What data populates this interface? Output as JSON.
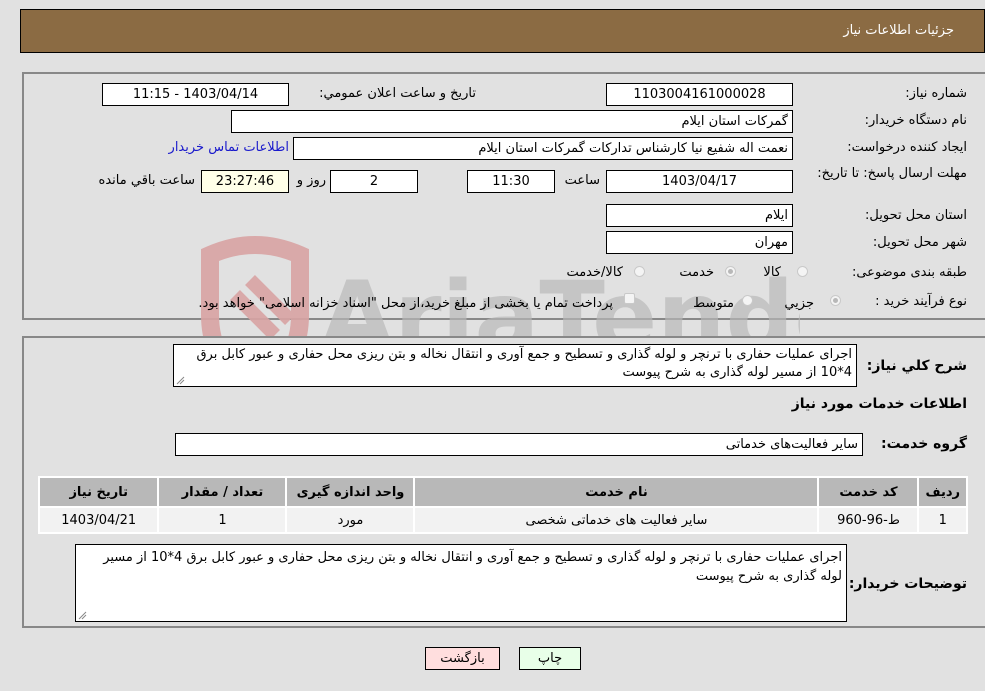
{
  "header": {
    "title": "جزئیات اطلاعات نیاز"
  },
  "info": {
    "need_number_label": "شماره نیاز:",
    "need_number": "1103004161000028",
    "announce_label": "تاريخ و ساعت اعلان عمومي:",
    "announce_value": "1403/04/14 - 11:15",
    "buyer_org_label": "نام دستگاه خريدار:",
    "buyer_org": "گمرکات استان ايلام",
    "creator_label": "ايجاد کننده درخواست:",
    "creator": "نعمت اله شفیع نیا کارشناس تدارکات گمرکات استان ایلام",
    "buyer_contact_link": "اطلاعات تماس خريدار",
    "deadline_label": "مهلت ارسال پاسخ: تا تاریخ:",
    "deadline_date": "1403/04/17",
    "time_label": "ساعت",
    "deadline_time": "11:30",
    "days_value": "2",
    "days_label": "روز و",
    "remaining_time": "23:27:46",
    "remaining_label": "ساعت باقي مانده",
    "province_label": "استان محل تحویل:",
    "province": "ایلام",
    "city_label": "شهر محل تحویل:",
    "city": "مهران",
    "category_label": "طبقه بندی موضوعی:",
    "category_options": [
      {
        "label": "کالا",
        "checked": false
      },
      {
        "label": "خدمت",
        "checked": true
      },
      {
        "label": "کالا/خدمت",
        "checked": false
      }
    ],
    "purchase_type_label": "نوع فرآیند خرید :",
    "purchase_type_options": [
      {
        "label": "جزيي",
        "checked": true
      },
      {
        "label": "متوسط",
        "checked": false
      }
    ],
    "treasury_note": "پرداخت تمام یا بخشی از مبلغ خرید،از محل \"اسناد خزانه اسلامی\" خواهد بود.",
    "treasury_checked": false
  },
  "details": {
    "general_desc_label": "شرح کلي نياز:",
    "general_desc": "اجرای عملیات حفاری با ترنچر و لوله گذاری و تسطیح و جمع آوری و انتقال نخاله و بتن ریزی محل حفاری و عبور کابل برق 4*10 از مسیر لوله گذاری به شرح پیوست",
    "services_heading": "اطلاعات خدمات مورد نياز",
    "service_group_label": "گروه خدمت:",
    "service_group": "سایر فعالیت‌های خدماتی",
    "table": {
      "headers": [
        "ردیف",
        "کد خدمت",
        "نام خدمت",
        "واحد اندازه گیری",
        "تعداد / مقدار",
        "تاریخ نیاز"
      ],
      "rows": [
        [
          "1",
          "ط-96-960",
          "سایر فعالیت های خدماتی شخصی",
          "مورد",
          "1",
          "1403/04/21"
        ]
      ]
    },
    "buyer_notes_label": "توضیحات خریدار:",
    "buyer_notes": "اجرای عملیات حفاری با ترنچر و لوله گذاری و تسطیح و جمع آوری و انتقال نخاله و بتن ریزی محل حفاری و عبور کابل برق 4*10 از مسیر لوله گذاری به شرح پیوست"
  },
  "buttons": {
    "print": "چاپ",
    "back": "بازگشت"
  },
  "watermark": {
    "text": "AriaTender.neT"
  }
}
